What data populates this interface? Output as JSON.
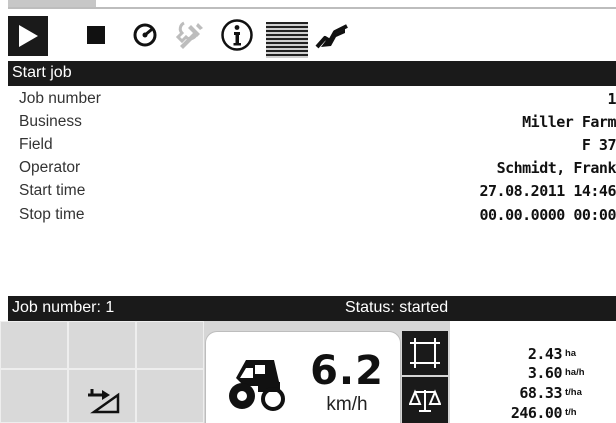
{
  "toolbar": {
    "buttons": [
      {
        "icon": "play-icon"
      },
      {
        "icon": "stop-icon"
      },
      {
        "icon": "gauge-icon"
      },
      {
        "icon": "tools-icon"
      },
      {
        "icon": "info-icon"
      },
      {
        "icon": "list-icon"
      },
      {
        "icon": "graph-icon"
      }
    ]
  },
  "job": {
    "title": "Start job",
    "fields": [
      {
        "label": "Job number",
        "value": "1"
      },
      {
        "label": "Business",
        "value": "Miller Farm"
      },
      {
        "label": "Field",
        "value": "F 37"
      },
      {
        "label": "Operator",
        "value": "Schmidt, Frank"
      },
      {
        "label": "Start time",
        "value": "27.08.2011 14:46"
      },
      {
        "label": "Stop time",
        "value": "00.00.0000 00:00"
      }
    ],
    "status_bar": {
      "job_number": "Job number: 1",
      "status": "Status: started"
    }
  },
  "bottom": {
    "speed": {
      "value": "6.2",
      "unit": "km/h"
    },
    "monitor": [
      {
        "value": "2.43",
        "unit": "ha"
      },
      {
        "value": "3.60",
        "unit": "ha/h"
      },
      {
        "value": "68.33",
        "unit": "t/ha"
      },
      {
        "value": "246.00",
        "unit": "t/h"
      }
    ]
  },
  "colors": {
    "bar_background": "#1a1a1a",
    "bar_text": "#ffffff",
    "softkey_background": "#d9d9d9"
  }
}
